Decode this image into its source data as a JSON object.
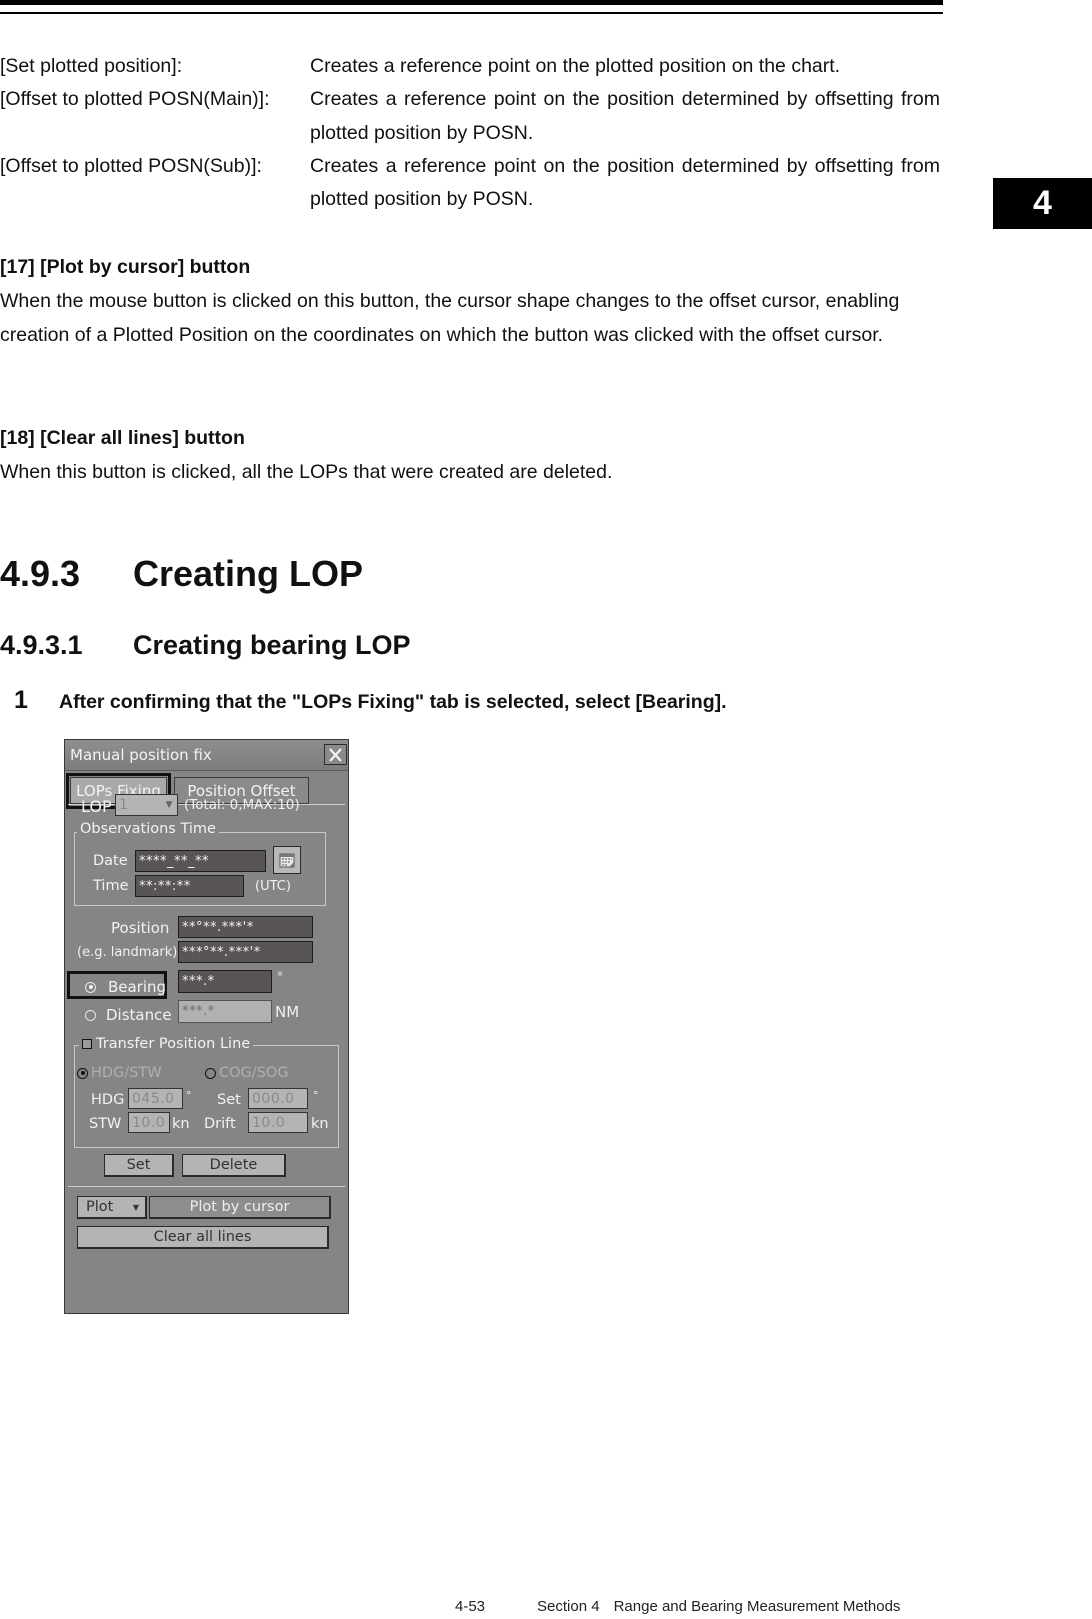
{
  "page": {
    "chapter_tab": "4",
    "definitions": [
      {
        "term": "[Set plotted position]:",
        "desc": "Creates a reference point on the plotted position on the chart."
      },
      {
        "term": "[Offset to plotted POSN(Main)]:",
        "desc": "Creates a reference point on the position determined by offsetting from plotted position by POSN."
      },
      {
        "term": "[Offset to plotted POSN(Sub)]:",
        "desc": "Creates a reference point on the position determined by offsetting from plotted position by POSN."
      }
    ],
    "item17": {
      "heading": "[17] [Plot by cursor] button",
      "body": "When the mouse button is clicked on this button, the cursor shape changes to the offset cursor, enabling creation of a Plotted Position on the coordinates on which the button was clicked with the offset cursor."
    },
    "item18": {
      "heading": "[18] [Clear all lines] button",
      "body": "When this button is clicked, all the LOPs that were created are deleted."
    },
    "section": {
      "number": "4.9.3",
      "title": "Creating LOP"
    },
    "subsection": {
      "number": "4.9.3.1",
      "title": "Creating bearing LOP"
    },
    "step": {
      "number": "1",
      "text": "After confirming that the \"LOPs Fixing\" tab is selected, select [Bearing]."
    },
    "footer": {
      "page": "4-53",
      "section": "Section 4",
      "title": "Range and Bearing Measurement Methods"
    }
  },
  "panel": {
    "title": "Manual position fix",
    "close_icon": "close-x-icon",
    "tabs": [
      {
        "label": "LOPs Fixing",
        "active": true
      },
      {
        "label": "Position Offset",
        "active": false
      }
    ],
    "lop": {
      "label": "LOP",
      "selected": "1",
      "total_text": "(Total:  0,MAX:10)"
    },
    "observations": {
      "title": "Observations Time",
      "date_label": "Date",
      "date_value": "****_**_**",
      "time_label": "Time",
      "time_value": "**:**:**",
      "utc_label": "(UTC)",
      "calendar_icon": "calendar-icon"
    },
    "position": {
      "label": "Position",
      "sublabel": "(e.g. landmark)",
      "lat_value": "**°**.***'*",
      "lon_value": "***°**.***'*"
    },
    "bearing": {
      "label": "Bearing",
      "value": "***.*",
      "unit": "°",
      "selected": true
    },
    "distance": {
      "label": "Distance",
      "value": "***.*",
      "unit": "NM",
      "selected": false
    },
    "transfer": {
      "title": "Transfer Position Line",
      "checked": false,
      "mode_options": [
        {
          "label": "HDG/STW",
          "selected": true
        },
        {
          "label": "COG/SOG",
          "selected": false
        }
      ],
      "hdg_label": "HDG",
      "hdg_value": "045.0",
      "hdg_unit": "°",
      "stw_label": "STW",
      "stw_value": "10.0",
      "stw_unit": "kn",
      "set_label": "Set",
      "set_value": "000.0",
      "set_unit": "°",
      "drift_label": "Drift",
      "drift_value": "10.0",
      "drift_unit": "kn"
    },
    "buttons": {
      "set": "Set",
      "delete": "Delete",
      "plot_dropdown": "Plot",
      "plot_by_cursor": "Plot by cursor",
      "clear_all": "Clear all lines"
    }
  }
}
